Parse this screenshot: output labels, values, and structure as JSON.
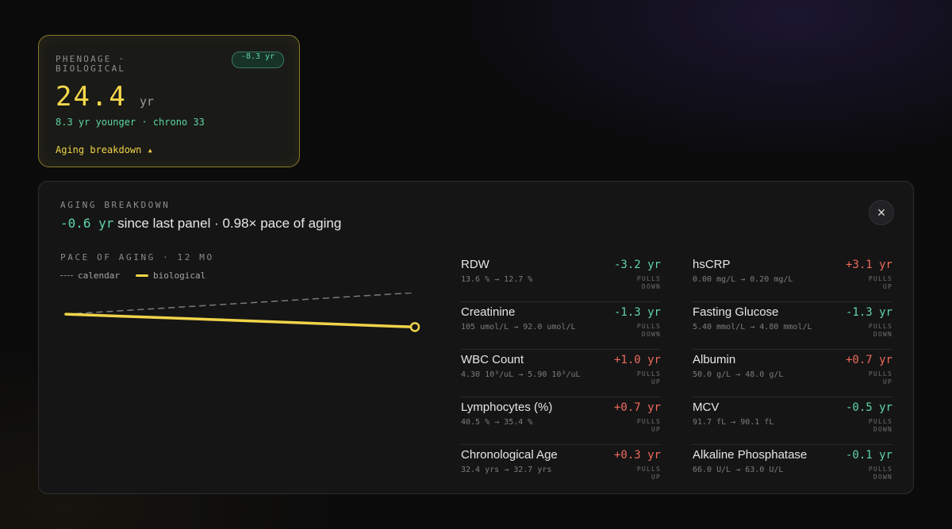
{
  "card": {
    "label": "PHENOAGE · BIOLOGICAL",
    "delta_pill": "-8.3 yr",
    "age_value": "24.4",
    "age_unit": "yr",
    "younger_text": "8.3 yr younger · chrono 33",
    "breakdown_toggle": "Aging breakdown ▴"
  },
  "panel": {
    "label": "AGING BREAKDOWN",
    "summary_delta": "-0.6 yr",
    "summary_text": " since last panel · 0.98× pace of aging",
    "pace_label": "PACE OF AGING · 12 MO",
    "legend": {
      "calendar": "calendar",
      "biological": "biological"
    },
    "close_icon": "×"
  },
  "chart_data": {
    "type": "line",
    "series": [
      {
        "name": "calendar",
        "style": "dashed",
        "color": "#7a7a7a",
        "values": [
          0.0,
          1.0
        ]
      },
      {
        "name": "biological",
        "style": "solid",
        "color": "#f0d448",
        "values": [
          0.0,
          -0.6
        ]
      }
    ],
    "x": [
      0,
      12
    ],
    "ylim": [
      -3.8,
      1.0
    ]
  },
  "biomarkers_left": [
    {
      "name": "RDW",
      "range": "13.6 % → 12.7 %",
      "delta": "-3.2 yr",
      "dir": "down",
      "effect": "PULLS DOWN"
    },
    {
      "name": "Creatinine",
      "range": "105 umol/L → 92.0 umol/L",
      "delta": "-1.3 yr",
      "dir": "down",
      "effect": "PULLS DOWN"
    },
    {
      "name": "WBC Count",
      "range": "4.30 10³/uL → 5.90 10³/uL",
      "delta": "+1.0 yr",
      "dir": "up",
      "effect": "PULLS UP"
    },
    {
      "name": "Lymphocytes (%)",
      "range": "40.5 % → 35.4 %",
      "delta": "+0.7 yr",
      "dir": "up",
      "effect": "PULLS UP"
    },
    {
      "name": "Chronological Age",
      "range": "32.4 yrs → 32.7 yrs",
      "delta": "+0.3 yr",
      "dir": "up",
      "effect": "PULLS UP"
    }
  ],
  "biomarkers_right": [
    {
      "name": "hsCRP",
      "range": "0.00 mg/L → 0.20 mg/L",
      "delta": "+3.1 yr",
      "dir": "up",
      "effect": "PULLS UP"
    },
    {
      "name": "Fasting Glucose",
      "range": "5.40 mmol/L → 4.80 mmol/L",
      "delta": "-1.3 yr",
      "dir": "down",
      "effect": "PULLS DOWN"
    },
    {
      "name": "Albumin",
      "range": "50.0 g/L → 48.0 g/L",
      "delta": "+0.7 yr",
      "dir": "up",
      "effect": "PULLS UP"
    },
    {
      "name": "MCV",
      "range": "91.7 fL → 90.1 fL",
      "delta": "-0.5 yr",
      "dir": "down",
      "effect": "PULLS DOWN"
    },
    {
      "name": "Alkaline Phosphatase",
      "range": "66.0 U/L → 63.0 U/L",
      "delta": "-0.1 yr",
      "dir": "down",
      "effect": "PULLS DOWN"
    }
  ]
}
